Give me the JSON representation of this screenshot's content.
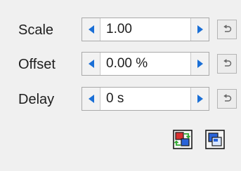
{
  "rows": [
    {
      "label": "Scale",
      "value": "1.00"
    },
    {
      "label": "Offset",
      "value": "0.00 %"
    },
    {
      "label": "Delay",
      "value": "0 s"
    }
  ],
  "icons": {
    "decrement": "triangle-left-icon",
    "increment": "triangle-right-icon",
    "reset": "undo-arrow-icon",
    "tool1": "swap-layers-icon",
    "tool2": "overlap-layers-icon"
  },
  "colors": {
    "background": "#f0f0f0",
    "arrow": "#1a6fd6",
    "border": "#a9a9a9"
  }
}
